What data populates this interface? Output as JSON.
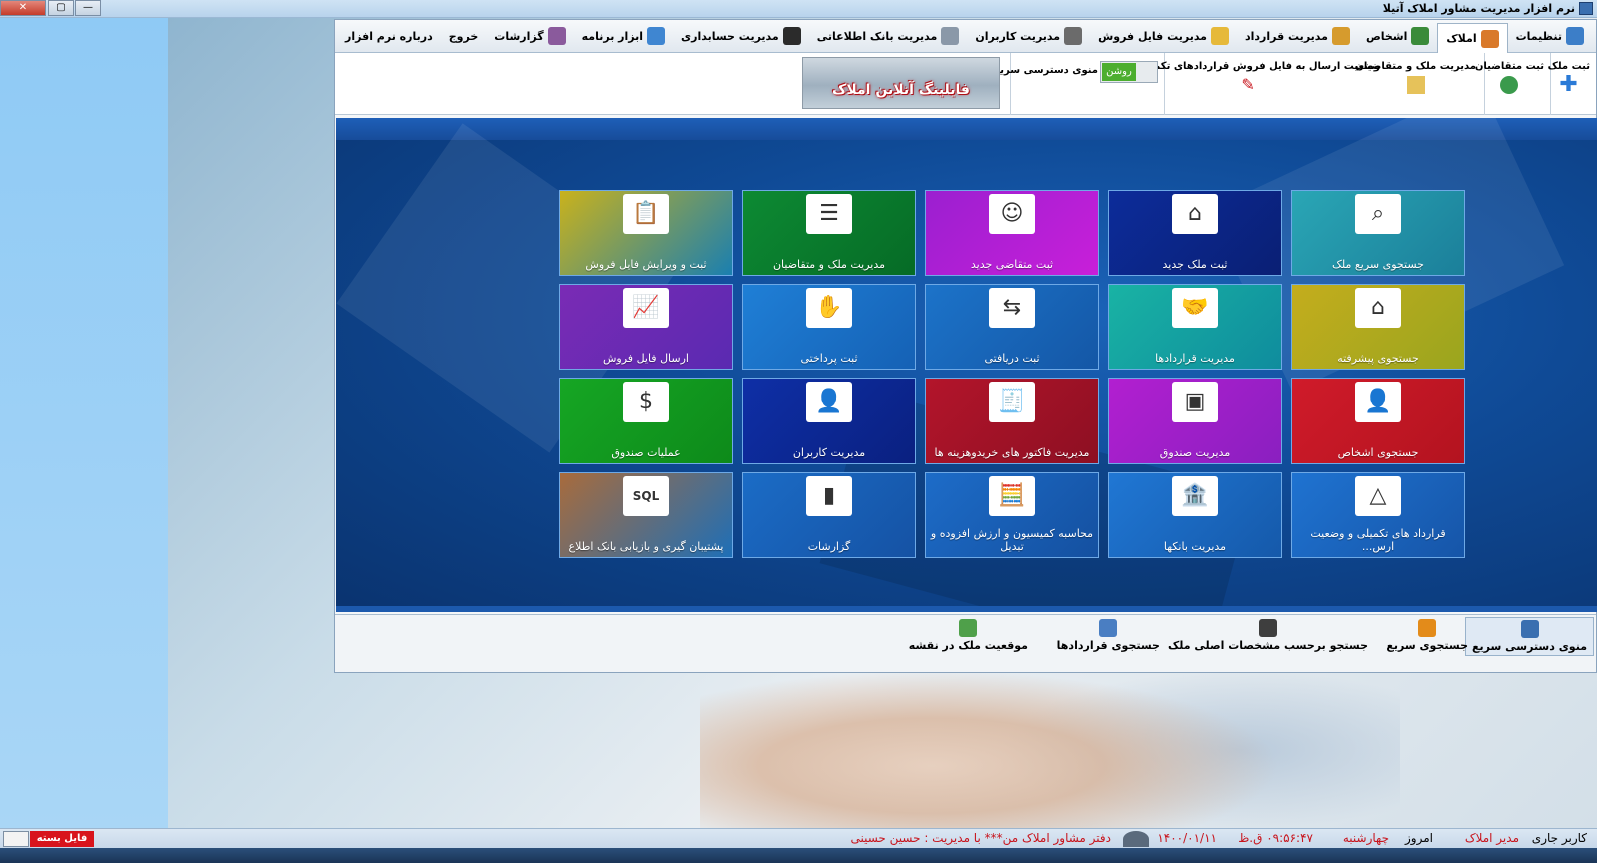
{
  "window": {
    "title": "نرم افزار مدیریت مشاور املاک آتیلا",
    "close_label": "✕",
    "max_label": "▢",
    "min_label": "—"
  },
  "menu": {
    "tabs": [
      {
        "label": "تنظیمات",
        "icon": "gear-icon",
        "color": "#3c7ec8"
      },
      {
        "label": "املاک",
        "icon": "house-icon",
        "color": "#d9792a",
        "active": true
      },
      {
        "label": "اشخاص",
        "icon": "people-icon",
        "color": "#3a8b3a"
      },
      {
        "label": "مدیریت قرارداد",
        "icon": "contract-icon",
        "color": "#d69b2d"
      },
      {
        "label": "مدیریت فایل فروش",
        "icon": "folder-icon",
        "color": "#e6b93a"
      },
      {
        "label": "مدیریت کاربران",
        "icon": "user-icon",
        "color": "#6b6b6b"
      },
      {
        "label": "مدیریت بانک اطلاعاتی",
        "icon": "database-icon",
        "color": "#8a98a8"
      },
      {
        "label": "مدیریت حسابداری",
        "icon": "dollar-icon",
        "color": "#2b2b2b"
      },
      {
        "label": "ابزار برنامه",
        "icon": "tools-icon",
        "color": "#3f86d1"
      },
      {
        "label": "گزارشات",
        "icon": "report-icon",
        "color": "#8a5a9c"
      },
      {
        "label": "خروج",
        "icon": "",
        "color": ""
      },
      {
        "label": "درباره نرم افزار",
        "icon": "",
        "color": ""
      }
    ]
  },
  "ribbon": {
    "register_property": "ثبت ملک",
    "register_applicants": "ثبت متقاضیان",
    "manage_property_applicants": "مدیریت ملک و متقاضیان",
    "send_status": "وضعیت ارسال به فایل فروش قراردادهای تکمیل شده",
    "quick_menu_label": "منوی دسترسی سریع",
    "toggle_on": "روشن",
    "banner_text": "فایلینگ آنلاین املاک"
  },
  "tiles": [
    {
      "label": "جستجوی سریع ملک",
      "icon": "search-property-icon",
      "glyph": "⌕",
      "bg": "linear-gradient(135deg,#2aa6b5,#1b7f9a)"
    },
    {
      "label": "ثبت ملک جدید",
      "icon": "new-house-icon",
      "glyph": "⌂",
      "bg": "linear-gradient(135deg,#0c2c9a,#0a1f74)"
    },
    {
      "label": "ثبت متقاضی جدید",
      "icon": "new-applicant-icon",
      "glyph": "☺",
      "bg": "linear-gradient(135deg,#9b1fd0,#c81fd9)"
    },
    {
      "label": "مدیریت ملک و متقاضیان",
      "icon": "manage-list-icon",
      "glyph": "☰",
      "bg": "linear-gradient(135deg,#0d8a33,#066b26)"
    },
    {
      "label": "ثبت و ویرایش فایل فروش",
      "icon": "clipboard-icon",
      "glyph": "📋",
      "bg": "linear-gradient(135deg,#c9b21c,#1a7fb0)"
    },
    {
      "label": "جستجوی پیشرفته",
      "icon": "advanced-search-icon",
      "glyph": "⌂",
      "bg": "linear-gradient(135deg,#c4ad1d,#9aa51e)"
    },
    {
      "label": "مدیریت قراردادها",
      "icon": "contract-handshake-icon",
      "glyph": "🤝",
      "bg": "linear-gradient(135deg,#19b3a4,#0f8c9d)"
    },
    {
      "label": "ثبت دریافتی",
      "icon": "receive-money-icon",
      "glyph": "⇆",
      "bg": "linear-gradient(135deg,#1c73c9,#1457a6)"
    },
    {
      "label": "ثبت پرداختی",
      "icon": "payment-icon",
      "glyph": "✋",
      "bg": "linear-gradient(135deg,#1f7fd6,#1561b5)"
    },
    {
      "label": "ارسال فایل فروش",
      "icon": "send-chart-icon",
      "glyph": "📈",
      "bg": "linear-gradient(135deg,#7a2bb5,#5a2ab1)"
    },
    {
      "label": "جستجوی اشخاص",
      "icon": "person-search-icon",
      "glyph": "👤",
      "bg": "linear-gradient(135deg,#d01b2a,#b3131f)"
    },
    {
      "label": "مدیریت صندوق",
      "icon": "safe-icon",
      "glyph": "▣",
      "bg": "linear-gradient(135deg,#b21fd0,#8a1fc0)"
    },
    {
      "label": "مدیریت فاکتور های خریدوهزینه ها",
      "icon": "invoice-icon",
      "glyph": "🧾",
      "bg": "linear-gradient(135deg,#b3152b,#8d0f22)"
    },
    {
      "label": "مدیریت کاربران",
      "icon": "users-manage-icon",
      "glyph": "👤",
      "bg": "linear-gradient(135deg,#0e2fa6,#0a2080)"
    },
    {
      "label": "عملیات صندوق",
      "icon": "cash-icon",
      "glyph": "$",
      "bg": "linear-gradient(135deg,#16a624,#0d8a1a)"
    },
    {
      "label": "قرارداد های تکمیلی و وضعیت ارس...",
      "icon": "complete-contract-icon",
      "glyph": "△",
      "bg": "linear-gradient(135deg,#1f73d1,#1655a8)"
    },
    {
      "label": "مدیریت بانکها",
      "icon": "bank-icon",
      "glyph": "🏦",
      "bg": "linear-gradient(135deg,#2077d4,#1559aa)"
    },
    {
      "label": "محاسبه کمیسیون و ارزش افزوده و تبدیل",
      "icon": "calculator-icon",
      "glyph": "🧮",
      "bg": "linear-gradient(135deg,#1d6cc8,#1450a0)"
    },
    {
      "label": "گزارشات",
      "icon": "reports-chart-icon",
      "glyph": "▮",
      "bg": "linear-gradient(135deg,#1b6cc6,#1552a4)"
    },
    {
      "label": "پشتیبان گیری و بازیابی بانک اطلاع",
      "icon": "sql-backup-icon",
      "glyph": "SQL",
      "bg": "linear-gradient(135deg,#a86b3c,#1e6fb7)"
    }
  ],
  "quickbar": {
    "items": [
      {
        "label": "منوی دسترسی سریع",
        "icon": "quick-menu-icon",
        "color": "#3a6fb0"
      },
      {
        "label": "جستجوی سریع",
        "icon": "quick-search-icon",
        "color": "#e38b1a"
      },
      {
        "label": "جستجو برحسب مشخصات اصلی ملک",
        "icon": "spec-search-icon",
        "color": "#3e3e3e"
      },
      {
        "label": "جستجوی قراردادها",
        "icon": "contract-search-icon",
        "color": "#4a7ec2"
      },
      {
        "label": "موقعیت ملک در نقشه",
        "icon": "map-icon",
        "color": "#4fa04a"
      }
    ]
  },
  "status": {
    "current_user_label": "کاربر جاری",
    "current_user": "مدیر املاک",
    "today_label": "امروز",
    "weekday": "چهارشنبه",
    "time": "۰۹:۵۶:۴۷ ق.ظ",
    "date": "۱۴۰۰/۰۱/۱۱",
    "office": "دفتر مشاور املاک من*** با مدیریت : حسین حسینی",
    "file_state": "فایل بسته است"
  }
}
